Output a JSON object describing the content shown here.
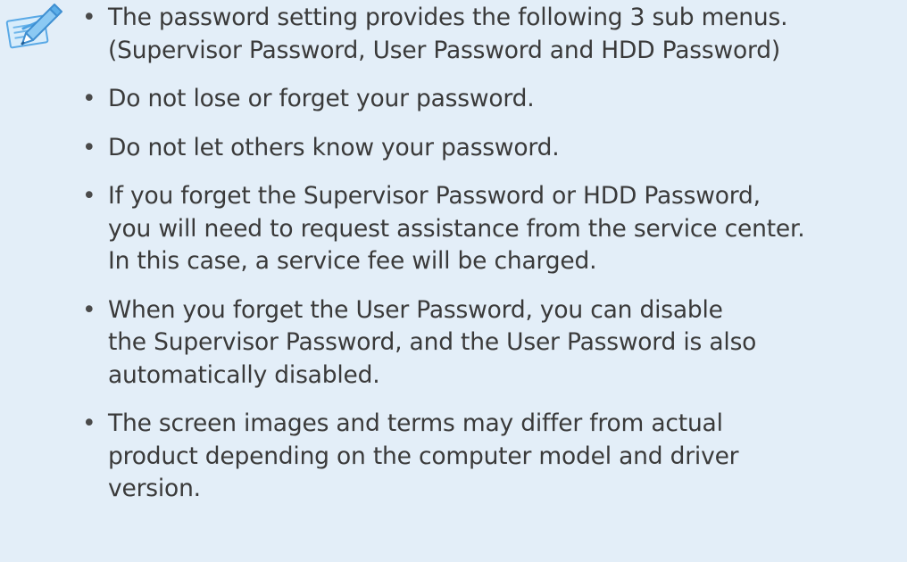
{
  "note": {
    "icon": "pen-on-notepad-icon",
    "bullet": "•",
    "items": [
      {
        "lines": [
          "The password setting provides the following 3 sub menus.",
          "(Supervisor Password, User Password and HDD Password)"
        ]
      },
      {
        "lines": [
          "Do not lose or forget your password."
        ]
      },
      {
        "lines": [
          "Do not let others know your password."
        ]
      },
      {
        "lines": [
          "If you forget the Supervisor Password or HDD Password,",
          "you will need to request assistance from the service center.",
          "In this case, a service fee will be charged."
        ]
      },
      {
        "lines": [
          "When you forget the User Password, you can disable",
          "the Supervisor Password, and the User Password is also",
          "automatically disabled."
        ]
      },
      {
        "lines": [
          "The screen images and terms may differ from actual",
          "product depending on the computer model and driver",
          "version."
        ]
      }
    ]
  }
}
